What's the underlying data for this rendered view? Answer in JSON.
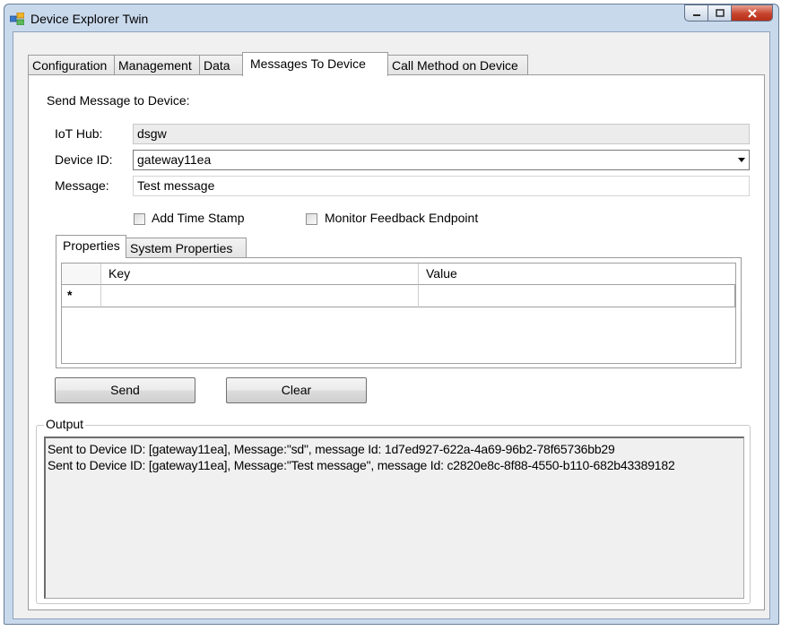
{
  "window": {
    "title": "Device Explorer Twin"
  },
  "tabs": [
    {
      "label": "Configuration"
    },
    {
      "label": "Management"
    },
    {
      "label": "Data"
    },
    {
      "label": "Messages To Device"
    },
    {
      "label": "Call Method on Device"
    }
  ],
  "active_tab": "Messages To Device",
  "form": {
    "heading": "Send Message to Device:",
    "iot_hub_label": "IoT Hub:",
    "iot_hub_value": "dsgw",
    "device_id_label": "Device ID:",
    "device_id_value": "gateway11ea",
    "message_label": "Message:",
    "message_value": "Test message",
    "add_timestamp_label": "Add Time Stamp",
    "add_timestamp_checked": false,
    "monitor_feedback_label": "Monitor Feedback Endpoint",
    "monitor_feedback_checked": false
  },
  "properties": {
    "tabs": [
      {
        "label": "Properties"
      },
      {
        "label": "System Properties"
      }
    ],
    "columns": [
      "Key",
      "Value"
    ],
    "new_row_marker": "*"
  },
  "buttons": {
    "send": "Send",
    "clear": "Clear"
  },
  "output": {
    "legend": "Output",
    "lines": [
      "Sent to Device ID: [gateway11ea], Message:\"sd\", message Id: 1d7ed927-622a-4a69-96b2-78f65736bb29",
      "Sent to Device ID: [gateway11ea], Message:\"Test message\", message Id: c2820e8c-8f88-4550-b110-682b43389182"
    ]
  }
}
